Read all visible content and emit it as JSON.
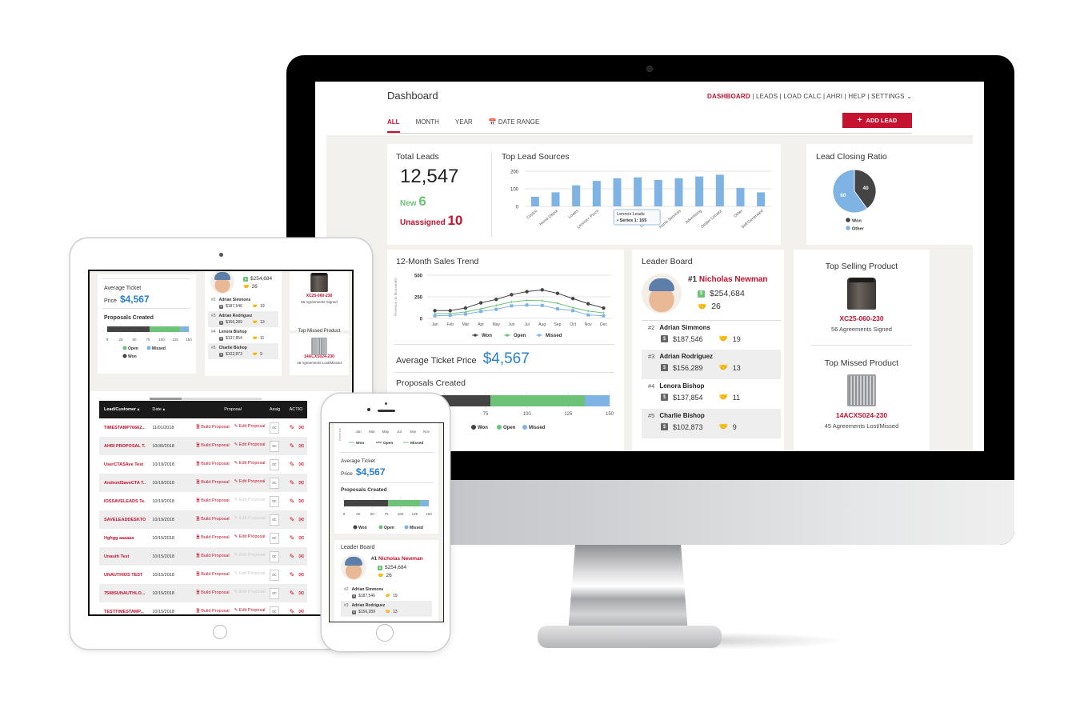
{
  "colors": {
    "brand_red": "#c41230",
    "accent_blue": "#2a7fc9",
    "won": "#444444",
    "open": "#6cc277",
    "missed": "#7fb3e3",
    "bar": "#7fb3e3"
  },
  "header": {
    "title": "Dashboard",
    "nav": [
      {
        "label": "DASHBOARD",
        "active": true
      },
      {
        "label": "LEADS"
      },
      {
        "label": "LOAD CALC"
      },
      {
        "label": "AHRI"
      },
      {
        "label": "HELP"
      },
      {
        "label": "SETTINGS"
      }
    ],
    "separator": "|",
    "tabs": [
      {
        "label": "ALL",
        "active": true
      },
      {
        "label": "MONTH"
      },
      {
        "label": "YEAR"
      },
      {
        "label": "DATE RANGE",
        "icon": "calendar-icon"
      }
    ],
    "add_lead_label": "ADD LEAD"
  },
  "total_leads": {
    "title": "Total Leads",
    "value": "12,547",
    "new_label": "New",
    "new_value": "6",
    "unassigned_label": "Unassigned",
    "unassigned_value": "10"
  },
  "lead_sources": {
    "title": "Top Lead Sources",
    "tooltip_title": "Lennox Leads",
    "tooltip_value": "Series 1: 165"
  },
  "closing_ratio": {
    "title": "Lead Closing Ratio"
  },
  "sales_trend": {
    "title": "12-Month Sales Trend"
  },
  "avg_ticket": {
    "label": "Average Ticket Price",
    "label_line1": "Average Ticket",
    "label_line2": "Price",
    "value": "$4,567"
  },
  "proposals": {
    "title": "Proposals Created"
  },
  "leaderboard": {
    "title": "Leader Board",
    "top": {
      "rank": "#1",
      "name": "Nicholas Newman",
      "revenue": "$254,684",
      "deals": "26"
    },
    "rows": [
      {
        "rank": "#2",
        "name": "Adrian Simmons",
        "revenue": "$187,546",
        "deals": "19"
      },
      {
        "rank": "#3",
        "name": "Adrian Rodriguez",
        "revenue": "$156,289",
        "deals": "13"
      },
      {
        "rank": "#4",
        "name": "Lenora Bishop",
        "revenue": "$137,854",
        "deals": "11"
      },
      {
        "rank": "#5",
        "name": "Charlie Bishop",
        "revenue": "$102,873",
        "deals": "9"
      }
    ]
  },
  "top_selling": {
    "title": "Top Selling Product",
    "model": "XC25-060-230",
    "caption": "56 Agreements Signed"
  },
  "top_missed": {
    "title": "Top Missed Product",
    "model": "14ACXS024-230",
    "caption": "45 Agreements Lost/Missed"
  },
  "leads_table": {
    "columns": [
      "Lead/Customer ▴",
      "Date ▴",
      "Proposal",
      "Assig",
      "ACTIO"
    ],
    "build_label": "Build Proposal",
    "edit_label": "Edit Proposal",
    "assign_placeholder": "oc",
    "rows": [
      {
        "name": "TIMESTAMP76662...",
        "date": "11/01/2018",
        "edit_enabled": true
      },
      {
        "name": "AHRI PROPOSAL T...",
        "date": "10/30/2018",
        "edit_enabled": true
      },
      {
        "name": "UserCTASAve Test",
        "date": "10/19/2018",
        "edit_enabled": true
      },
      {
        "name": "AndroidSaveCTA T...",
        "date": "10/19/2018",
        "edit_enabled": true
      },
      {
        "name": "IOSSAVELEADS Te...",
        "date": "10/19/2018",
        "edit_enabled": false
      },
      {
        "name": "SAVELEADDESKTO...",
        "date": "10/19/2018",
        "edit_enabled": false
      },
      {
        "name": "Hghgg aaaaaa",
        "date": "10/15/2018",
        "edit_enabled": true
      },
      {
        "name": "Unauth Test",
        "date": "10/15/2018",
        "edit_enabled": false
      },
      {
        "name": "UNAUTHIOS TEST",
        "date": "10/15/2018",
        "edit_enabled": false
      },
      {
        "name": "7508SUNAUTHLO...",
        "date": "10/15/2018",
        "edit_enabled": false
      },
      {
        "name": "TESTTIMESTAMP...",
        "date": "10/15/2018",
        "edit_enabled": true
      }
    ]
  },
  "chart_data": [
    {
      "type": "bar",
      "title": "Top Lead Sources",
      "categories": [
        "Costco",
        "Home Depot",
        "Lowes",
        "Lennox+ Porch",
        "",
        "Lennox Leads",
        "Home Services",
        "Advertising",
        "Dealer Locator",
        "Other",
        "Self-Generated"
      ],
      "values": [
        55,
        80,
        120,
        145,
        160,
        165,
        150,
        160,
        170,
        180,
        105,
        80
      ],
      "series_name": "Series 1",
      "yticks": [
        0,
        100,
        200
      ],
      "ylim": [
        0,
        200
      ],
      "grid": true
    },
    {
      "type": "pie",
      "title": "Lead Closing Ratio",
      "labels": [
        "Won",
        "Other"
      ],
      "values": [
        40,
        60
      ],
      "legend": "bottom"
    },
    {
      "type": "line",
      "title": "12-Month Sales Trend",
      "ylabel": "Revenue (in thousands)",
      "x": [
        "Jan",
        "Feb",
        "Mar",
        "Apr",
        "May",
        "Jun",
        "Jul",
        "Aug",
        "Sep",
        "Oct",
        "Nov",
        "Dec"
      ],
      "yticks": [
        0,
        250,
        500
      ],
      "ylim": [
        0,
        500
      ],
      "series": [
        {
          "name": "Won",
          "values": [
            90,
            90,
            120,
            180,
            220,
            275,
            310,
            330,
            290,
            230,
            170,
            120
          ]
        },
        {
          "name": "Open",
          "values": [
            55,
            55,
            75,
            110,
            150,
            190,
            210,
            205,
            175,
            125,
            85,
            65
          ]
        },
        {
          "name": "Missed",
          "values": [
            30,
            35,
            50,
            80,
            105,
            145,
            155,
            150,
            110,
            90,
            40,
            30
          ]
        }
      ],
      "legend": "bottom",
      "grid": true
    },
    {
      "type": "bar",
      "orientation": "horizontal-stacked",
      "title": "Proposals Created",
      "series": [
        {
          "name": "Won",
          "value": 78
        },
        {
          "name": "Open",
          "value": 57
        },
        {
          "name": "Missed",
          "value": 15
        }
      ],
      "xticks": [
        0,
        25,
        50,
        75,
        100,
        125,
        150
      ],
      "xlim": [
        0,
        150
      ],
      "legend": "bottom"
    }
  ]
}
